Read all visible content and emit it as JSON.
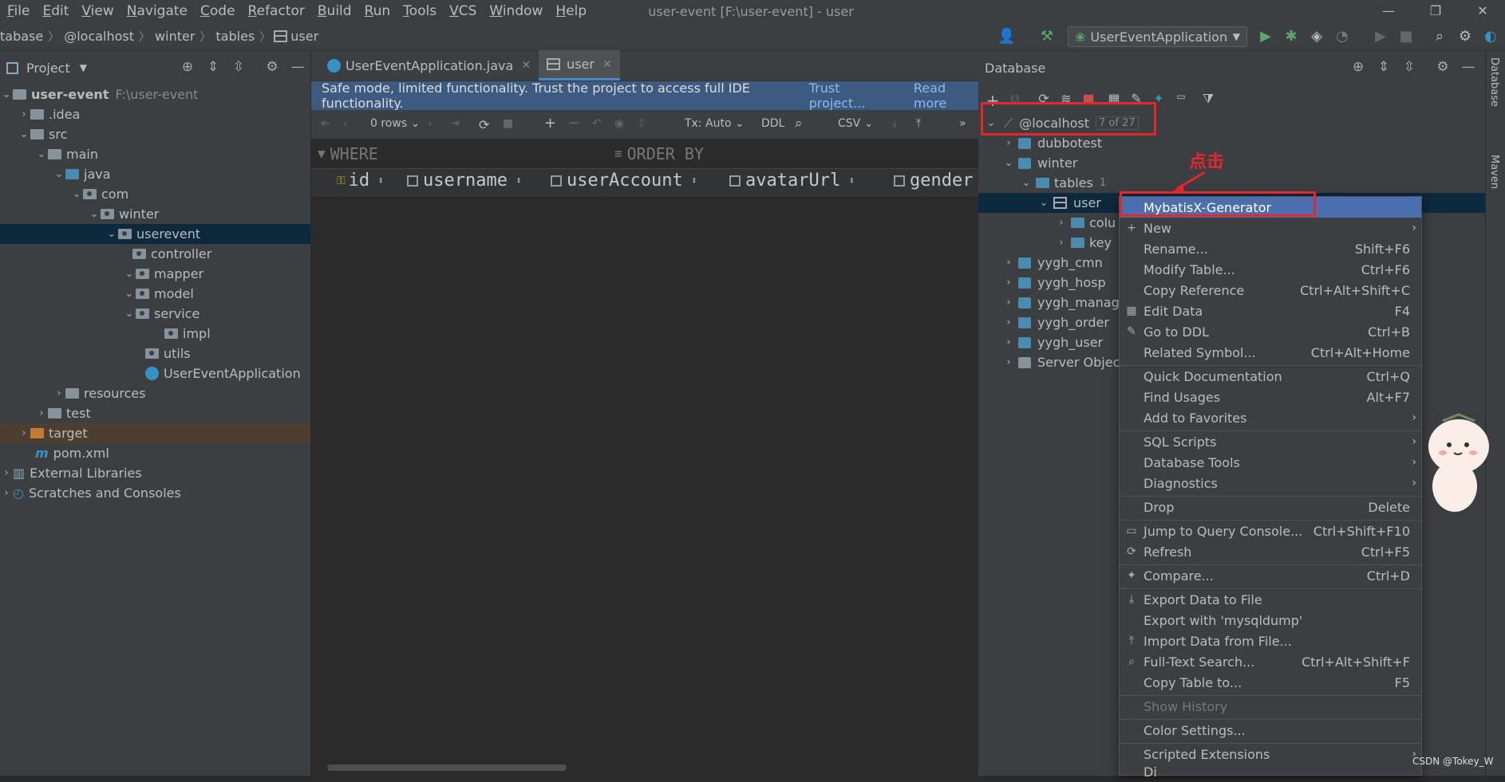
{
  "menubar": {
    "items": [
      "File",
      "Edit",
      "View",
      "Navigate",
      "Code",
      "Refactor",
      "Build",
      "Run",
      "Tools",
      "VCS",
      "Window",
      "Help"
    ],
    "title": "user-event [F:\\user-event] - user",
    "min": "—",
    "max": "❐",
    "close": "✕"
  },
  "breadcrumb": {
    "items": [
      "tabase",
      "@localhost",
      "winter",
      "tables",
      "user"
    ]
  },
  "run_config": {
    "label": "UserEventApplication"
  },
  "project": {
    "title": "Project",
    "tree": [
      {
        "label": "user-event",
        "extra": "F:\\user-event"
      },
      {
        "label": ".idea"
      },
      {
        "label": "src"
      },
      {
        "label": "main"
      },
      {
        "label": "java"
      },
      {
        "label": "com"
      },
      {
        "label": "winter"
      },
      {
        "label": "userevent"
      },
      {
        "label": "controller"
      },
      {
        "label": "mapper"
      },
      {
        "label": "model"
      },
      {
        "label": "service"
      },
      {
        "label": "impl"
      },
      {
        "label": "utils"
      },
      {
        "label": "UserEventApplication"
      },
      {
        "label": "resources"
      },
      {
        "label": "test"
      },
      {
        "label": "target"
      },
      {
        "label": "pom.xml"
      },
      {
        "label": "External Libraries"
      },
      {
        "label": "Scratches and Consoles"
      }
    ]
  },
  "editor": {
    "tabs": [
      {
        "label": "UserEventApplication.java"
      },
      {
        "label": "user"
      }
    ],
    "banner": {
      "text": "Safe mode, limited functionality. Trust the project to access full IDE functionality.",
      "trust": "Trust project...",
      "read": "Read more"
    },
    "toolbar": {
      "rows": "0 rows",
      "tx": "Tx: Auto",
      "ddl": "DDL",
      "csv": "CSV"
    },
    "filter": {
      "where": "WHERE",
      "order": "ORDER BY"
    },
    "columns": [
      "id",
      "username",
      "userAccount",
      "avatarUrl",
      "gender"
    ]
  },
  "db": {
    "title": "Database",
    "localhost": "@localhost",
    "count": "7 of 27",
    "tree": [
      {
        "label": "dubbotest"
      },
      {
        "label": "winter"
      },
      {
        "label": "tables",
        "count": "1"
      },
      {
        "label": "user"
      },
      {
        "label": "colu"
      },
      {
        "label": "key"
      },
      {
        "label": "yygh_cmn"
      },
      {
        "label": "yygh_hosp"
      },
      {
        "label": "yygh_manage"
      },
      {
        "label": "yygh_order"
      },
      {
        "label": "yygh_user"
      },
      {
        "label": "Server Objec"
      }
    ]
  },
  "annotation": "点击",
  "context_menu": [
    {
      "label": "MybatisX-Generator",
      "shortcut": ""
    },
    {
      "label": "New",
      "shortcut": ""
    },
    {
      "label": "Rename...",
      "shortcut": "Shift+F6"
    },
    {
      "label": "Modify Table...",
      "shortcut": "Ctrl+F6"
    },
    {
      "label": "Copy Reference",
      "shortcut": "Ctrl+Alt+Shift+C"
    },
    {
      "label": "Edit Data",
      "shortcut": "F4"
    },
    {
      "label": "Go to DDL",
      "shortcut": "Ctrl+B"
    },
    {
      "label": "Related Symbol...",
      "shortcut": "Ctrl+Alt+Home"
    },
    {
      "label": "Quick Documentation",
      "shortcut": "Ctrl+Q"
    },
    {
      "label": "Find Usages",
      "shortcut": "Alt+F7"
    },
    {
      "label": "Add to Favorites",
      "shortcut": ""
    },
    {
      "label": "SQL Scripts",
      "shortcut": ""
    },
    {
      "label": "Database Tools",
      "shortcut": ""
    },
    {
      "label": "Diagnostics",
      "shortcut": ""
    },
    {
      "label": "Drop",
      "shortcut": "Delete"
    },
    {
      "label": "Jump to Query Console...",
      "shortcut": "Ctrl+Shift+F10"
    },
    {
      "label": "Refresh",
      "shortcut": "Ctrl+F5"
    },
    {
      "label": "Compare...",
      "shortcut": "Ctrl+D"
    },
    {
      "label": "Export Data to File",
      "shortcut": ""
    },
    {
      "label": "Export with 'mysqldump'",
      "shortcut": ""
    },
    {
      "label": "Import Data from File...",
      "shortcut": ""
    },
    {
      "label": "Full-Text Search...",
      "shortcut": "Ctrl+Alt+Shift+F"
    },
    {
      "label": "Copy Table to...",
      "shortcut": "F5"
    },
    {
      "label": "Show History",
      "shortcut": ""
    },
    {
      "label": "Color Settings...",
      "shortcut": ""
    },
    {
      "label": "Scripted Extensions",
      "shortcut": ""
    },
    {
      "label": "Di",
      "shortcut": ""
    }
  ],
  "side_tabs": {
    "database": "Database",
    "maven": "Maven"
  },
  "watermark": "CSDN @Tokey_W",
  "colors": {
    "accent": "#4b6eaf",
    "annotation": "#e5262b",
    "banner": "#3d5a80"
  }
}
